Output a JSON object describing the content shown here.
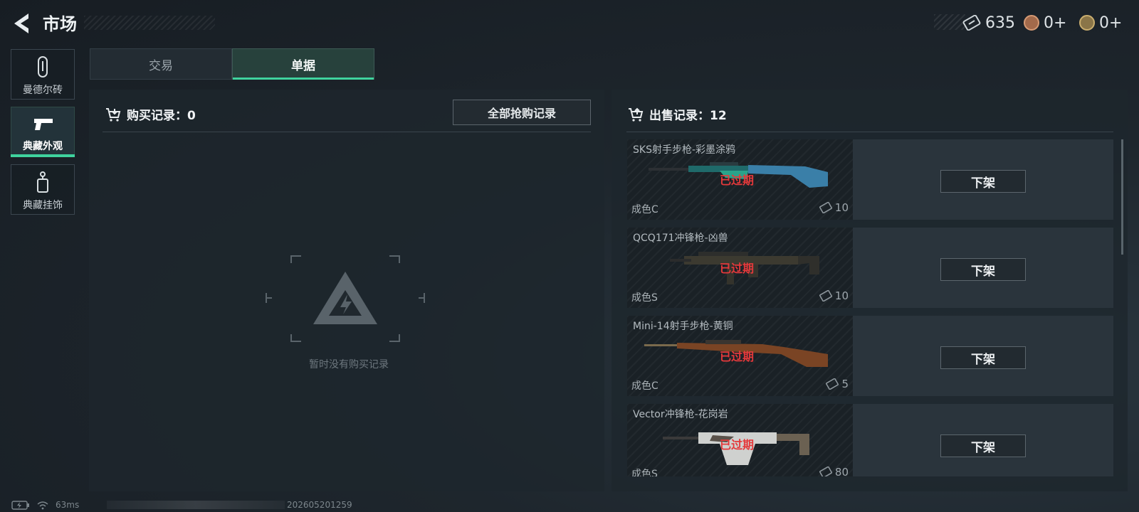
{
  "header": {
    "title": "市场",
    "currencies": [
      {
        "name": "ticket-currency",
        "value": "635"
      },
      {
        "name": "bronze-currency",
        "value": "0+"
      },
      {
        "name": "gold-currency",
        "value": "0+"
      }
    ]
  },
  "sidebar": {
    "items": [
      {
        "label": "曼德尔砖",
        "icon": "mandel-brick-icon",
        "active": false
      },
      {
        "label": "典藏外观",
        "icon": "pistol-icon",
        "active": true
      },
      {
        "label": "典藏挂饰",
        "icon": "charm-tag-icon",
        "active": false
      }
    ]
  },
  "tabs": [
    {
      "label": "交易",
      "active": false
    },
    {
      "label": "单据",
      "active": true
    }
  ],
  "purchase": {
    "title": "购买记录：",
    "count": "0",
    "all_button": "全部抢购记录",
    "empty_text": "暂时没有购买记录"
  },
  "sales": {
    "title": "出售记录：",
    "count": "12",
    "records": [
      {
        "name": "SKS射手步枪-彩墨涂鸦",
        "status": "已过期",
        "grade": "成色C",
        "price": "10",
        "action": "下架"
      },
      {
        "name": "QCQ171冲锋枪-凶兽",
        "status": "已过期",
        "grade": "成色S",
        "price": "10",
        "action": "下架"
      },
      {
        "name": "Mini-14射手步枪-黄铜",
        "status": "已过期",
        "grade": "成色C",
        "price": "5",
        "action": "下架"
      },
      {
        "name": "Vector冲锋枪-花岗岩",
        "status": "已过期",
        "grade": "成色S",
        "price": "80",
        "action": "下架"
      }
    ]
  },
  "footer": {
    "ping": "63ms",
    "timestamp": "202605201259"
  },
  "colors": {
    "accent": "#3fd39e",
    "expired": "#e5393b"
  }
}
